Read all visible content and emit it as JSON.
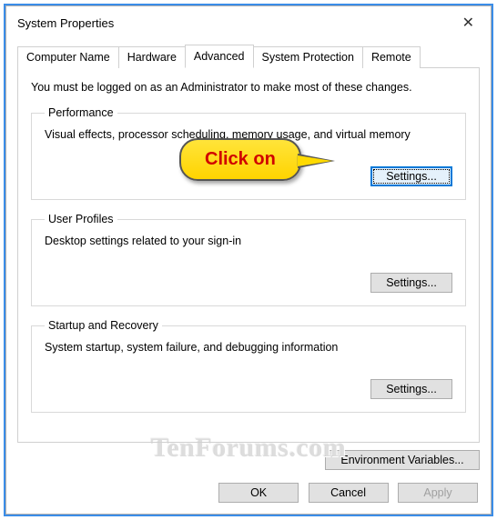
{
  "window": {
    "title": "System Properties"
  },
  "tabs": {
    "computer_name": "Computer Name",
    "hardware": "Hardware",
    "advanced": "Advanced",
    "system_protection": "System Protection",
    "remote": "Remote"
  },
  "hint": "You must be logged on as an Administrator to make most of these changes.",
  "groups": {
    "performance": {
      "legend": "Performance",
      "desc": "Visual effects, processor scheduling, memory usage, and virtual memory",
      "button": "Settings..."
    },
    "user_profiles": {
      "legend": "User Profiles",
      "desc": "Desktop settings related to your sign-in",
      "button": "Settings..."
    },
    "startup": {
      "legend": "Startup and Recovery",
      "desc": "System startup, system failure, and debugging information",
      "button": "Settings..."
    }
  },
  "env_button": "Environment Variables...",
  "buttons": {
    "ok": "OK",
    "cancel": "Cancel",
    "apply": "Apply"
  },
  "callout": "Click on",
  "watermark": "TenForums.com"
}
